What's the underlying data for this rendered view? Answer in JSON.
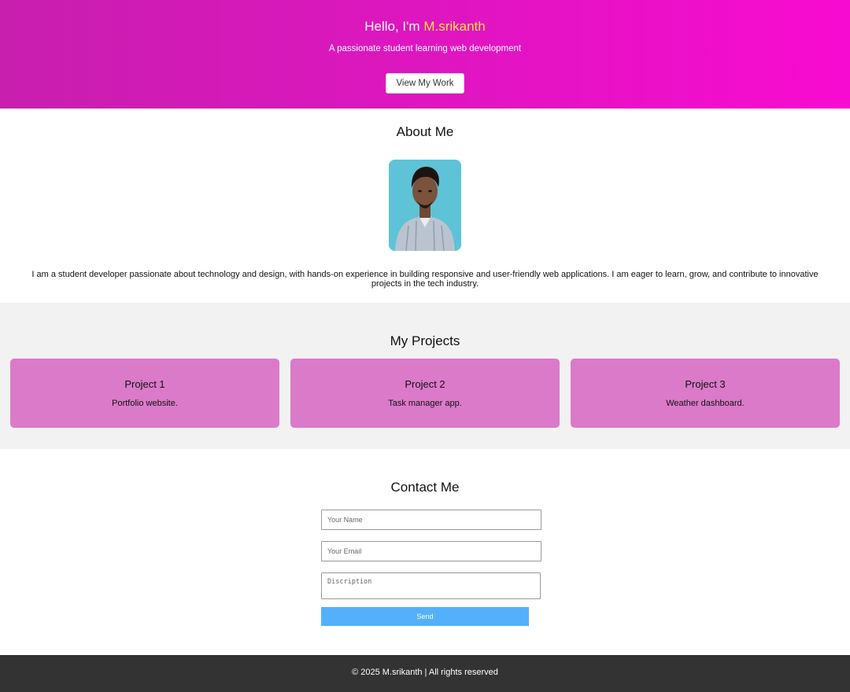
{
  "hero": {
    "greeting": "Hello, I'm",
    "name": "M.srikanth",
    "tagline": "A passionate student learning web development",
    "button_label": "View My Work"
  },
  "about": {
    "title": "About Me",
    "bio": "I am a student developer passionate about technology and design, with hands-on experience in building responsive and user-friendly web applications. I am eager to learn, grow, and contribute to innovative projects in the tech industry."
  },
  "projects": {
    "title": "My Projects",
    "items": [
      {
        "title": "Project 1",
        "description": "Portfolio website."
      },
      {
        "title": "Project 2",
        "description": "Task manager app."
      },
      {
        "title": "Project 3",
        "description": "Weather dashboard."
      }
    ]
  },
  "contact": {
    "title": "Contact Me",
    "name_placeholder": "Your Name",
    "email_placeholder": "Your Email",
    "description_placeholder": "Discription",
    "send_label": "Send"
  },
  "footer": {
    "text": "© 2025 M.srikanth | All rights reserved"
  },
  "colors": {
    "hero_gradient_start": "#c81fae",
    "hero_gradient_end": "#f80bd0",
    "name_highlight": "#ffe23a",
    "card_background": "#db7ac9",
    "send_button": "#55b0fc",
    "footer_background": "#333333"
  }
}
